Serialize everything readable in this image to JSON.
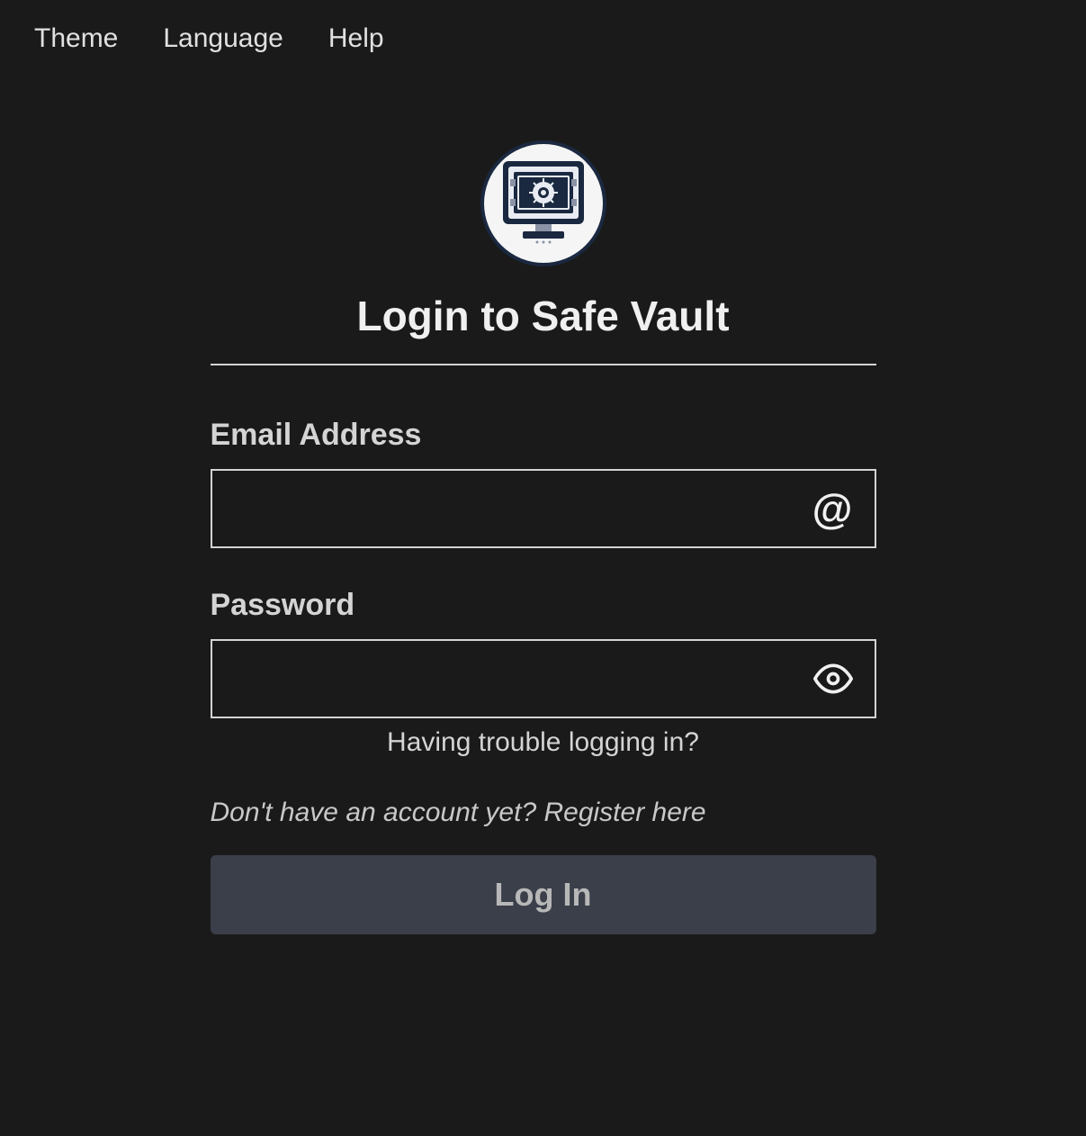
{
  "topbar": {
    "theme": "Theme",
    "language": "Language",
    "help": "Help"
  },
  "heading": "Login to Safe Vault",
  "email": {
    "label": "Email Address",
    "value": "",
    "icon_glyph": "@"
  },
  "password": {
    "label": "Password",
    "value": ""
  },
  "trouble_text": "Having trouble logging in?",
  "register_text": "Don't have an account yet? Register here",
  "login_button": "Log In"
}
